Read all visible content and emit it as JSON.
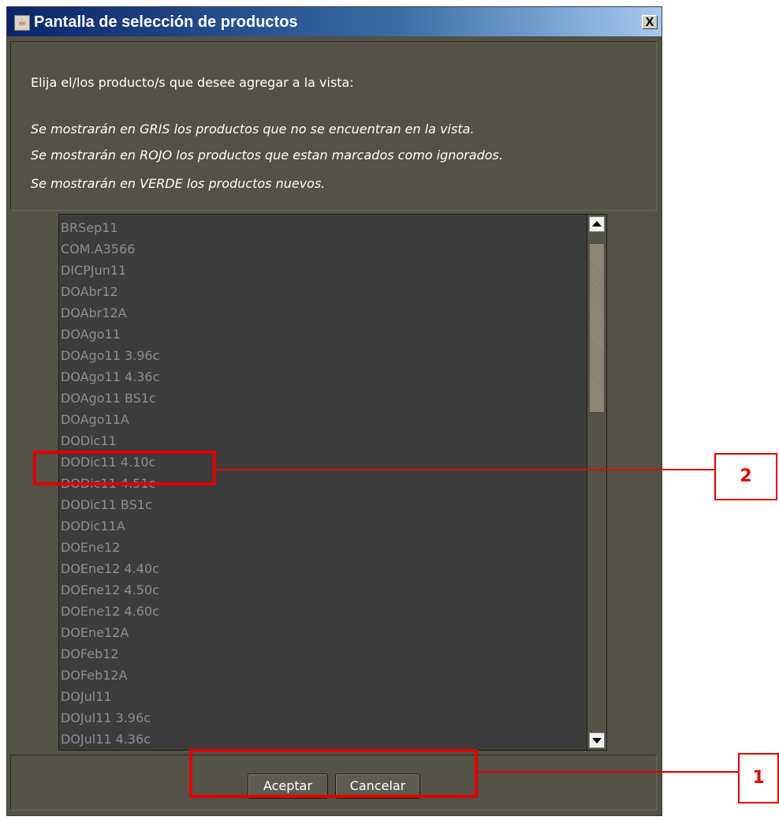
{
  "window": {
    "title": "Pantalla de selección de productos",
    "app_icon": "java-icon",
    "close_label": "X"
  },
  "info": {
    "prompt": "Elija el/los producto/s que desee agregar a la vista:",
    "legend_gray": "Se mostrarán en GRIS los productos que no se encuentran en la vista.",
    "legend_red": "Se mostrarán en ROJO los productos que estan marcados como ignorados.",
    "legend_green": "Se mostrarán en VERDE los productos nuevos."
  },
  "products": [
    "BRSep11",
    "COM.A3566",
    "DICPJun11",
    "DOAbr12",
    "DOAbr12A",
    "DOAgo11",
    "DOAgo11 3.96c",
    "DOAgo11 4.36c",
    "DOAgo11 BS1c",
    "DOAgo11A",
    "DODic11",
    "DODic11 4.10c",
    "DODic11 4.51c",
    "DODic11 BS1c",
    "DODic11A",
    "DOEne12",
    "DOEne12 4.40c",
    "DOEne12 4.50c",
    "DOEne12 4.60c",
    "DOEne12A",
    "DOFeb12",
    "DOFeb12A",
    "DOJul11",
    "DOJul11 3.96c",
    "DOJul11 4.36c"
  ],
  "buttons": {
    "accept": "Aceptar",
    "cancel": "Cancelar"
  },
  "annotations": {
    "callout_1": "1",
    "callout_2": "2",
    "color": "#e00000"
  },
  "colors": {
    "dialog_bg": "#545146",
    "list_bg": "#3c3c3c",
    "item_text_gray": "#8e8e8e"
  }
}
